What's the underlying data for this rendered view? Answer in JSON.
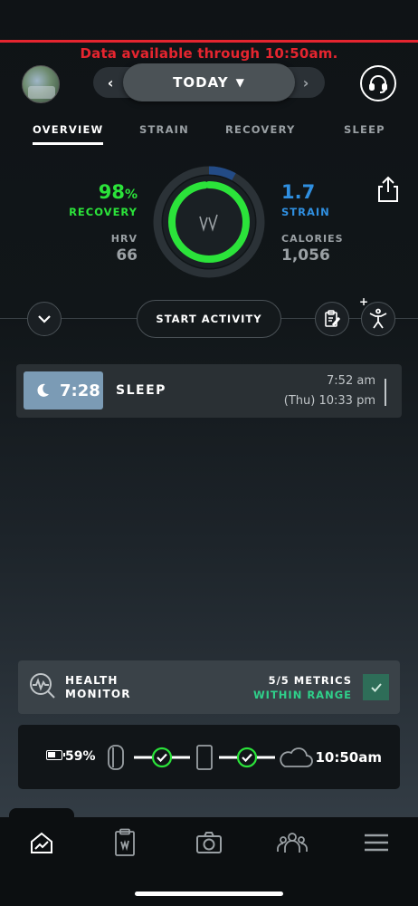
{
  "banner": {
    "text": "Data available through 10:50am."
  },
  "header": {
    "date_label": "TODAY",
    "prev_arrow": "‹",
    "next_arrow": "›"
  },
  "tabs": [
    {
      "label": "OVERVIEW",
      "active": true
    },
    {
      "label": "STRAIN",
      "active": false
    },
    {
      "label": "RECOVERY",
      "active": false
    },
    {
      "label": "SLEEP",
      "active": false
    }
  ],
  "overview": {
    "recovery": {
      "value": "98",
      "unit": "%",
      "label": "RECOVERY",
      "color": "#2be33a"
    },
    "hrv": {
      "label": "HRV",
      "value": "66"
    },
    "strain": {
      "value": "1.7",
      "label": "STRAIN",
      "color": "#2f8fe0"
    },
    "calories": {
      "label": "CALORIES",
      "value": "1,056"
    },
    "dial": {
      "recovery_fraction": 0.98,
      "strain_fraction": 0.08
    }
  },
  "actions": {
    "start_activity": "START ACTIVITY",
    "add_plus": "+"
  },
  "sleep": {
    "duration": "7:28",
    "title": "SLEEP",
    "end_time": "7:52 am",
    "start_time": "(Thu) 10:33 pm",
    "badge_color": "#7b9bb5"
  },
  "health_monitor": {
    "title_line1": "HEALTH",
    "title_line2": "MONITOR",
    "metrics_count": "5/5 METRICS",
    "status": "WITHIN RANGE",
    "status_color": "#2fd08a"
  },
  "sync": {
    "battery_percent": "59%",
    "last_sync": "10:50am",
    "check_color": "#2be33a"
  },
  "bottom_nav": [
    {
      "icon": "home-icon",
      "active": true
    },
    {
      "icon": "journal-clipboard-icon",
      "active": false
    },
    {
      "icon": "camera-icon",
      "active": false
    },
    {
      "icon": "community-icon",
      "active": false
    },
    {
      "icon": "menu-icon",
      "active": false
    }
  ]
}
